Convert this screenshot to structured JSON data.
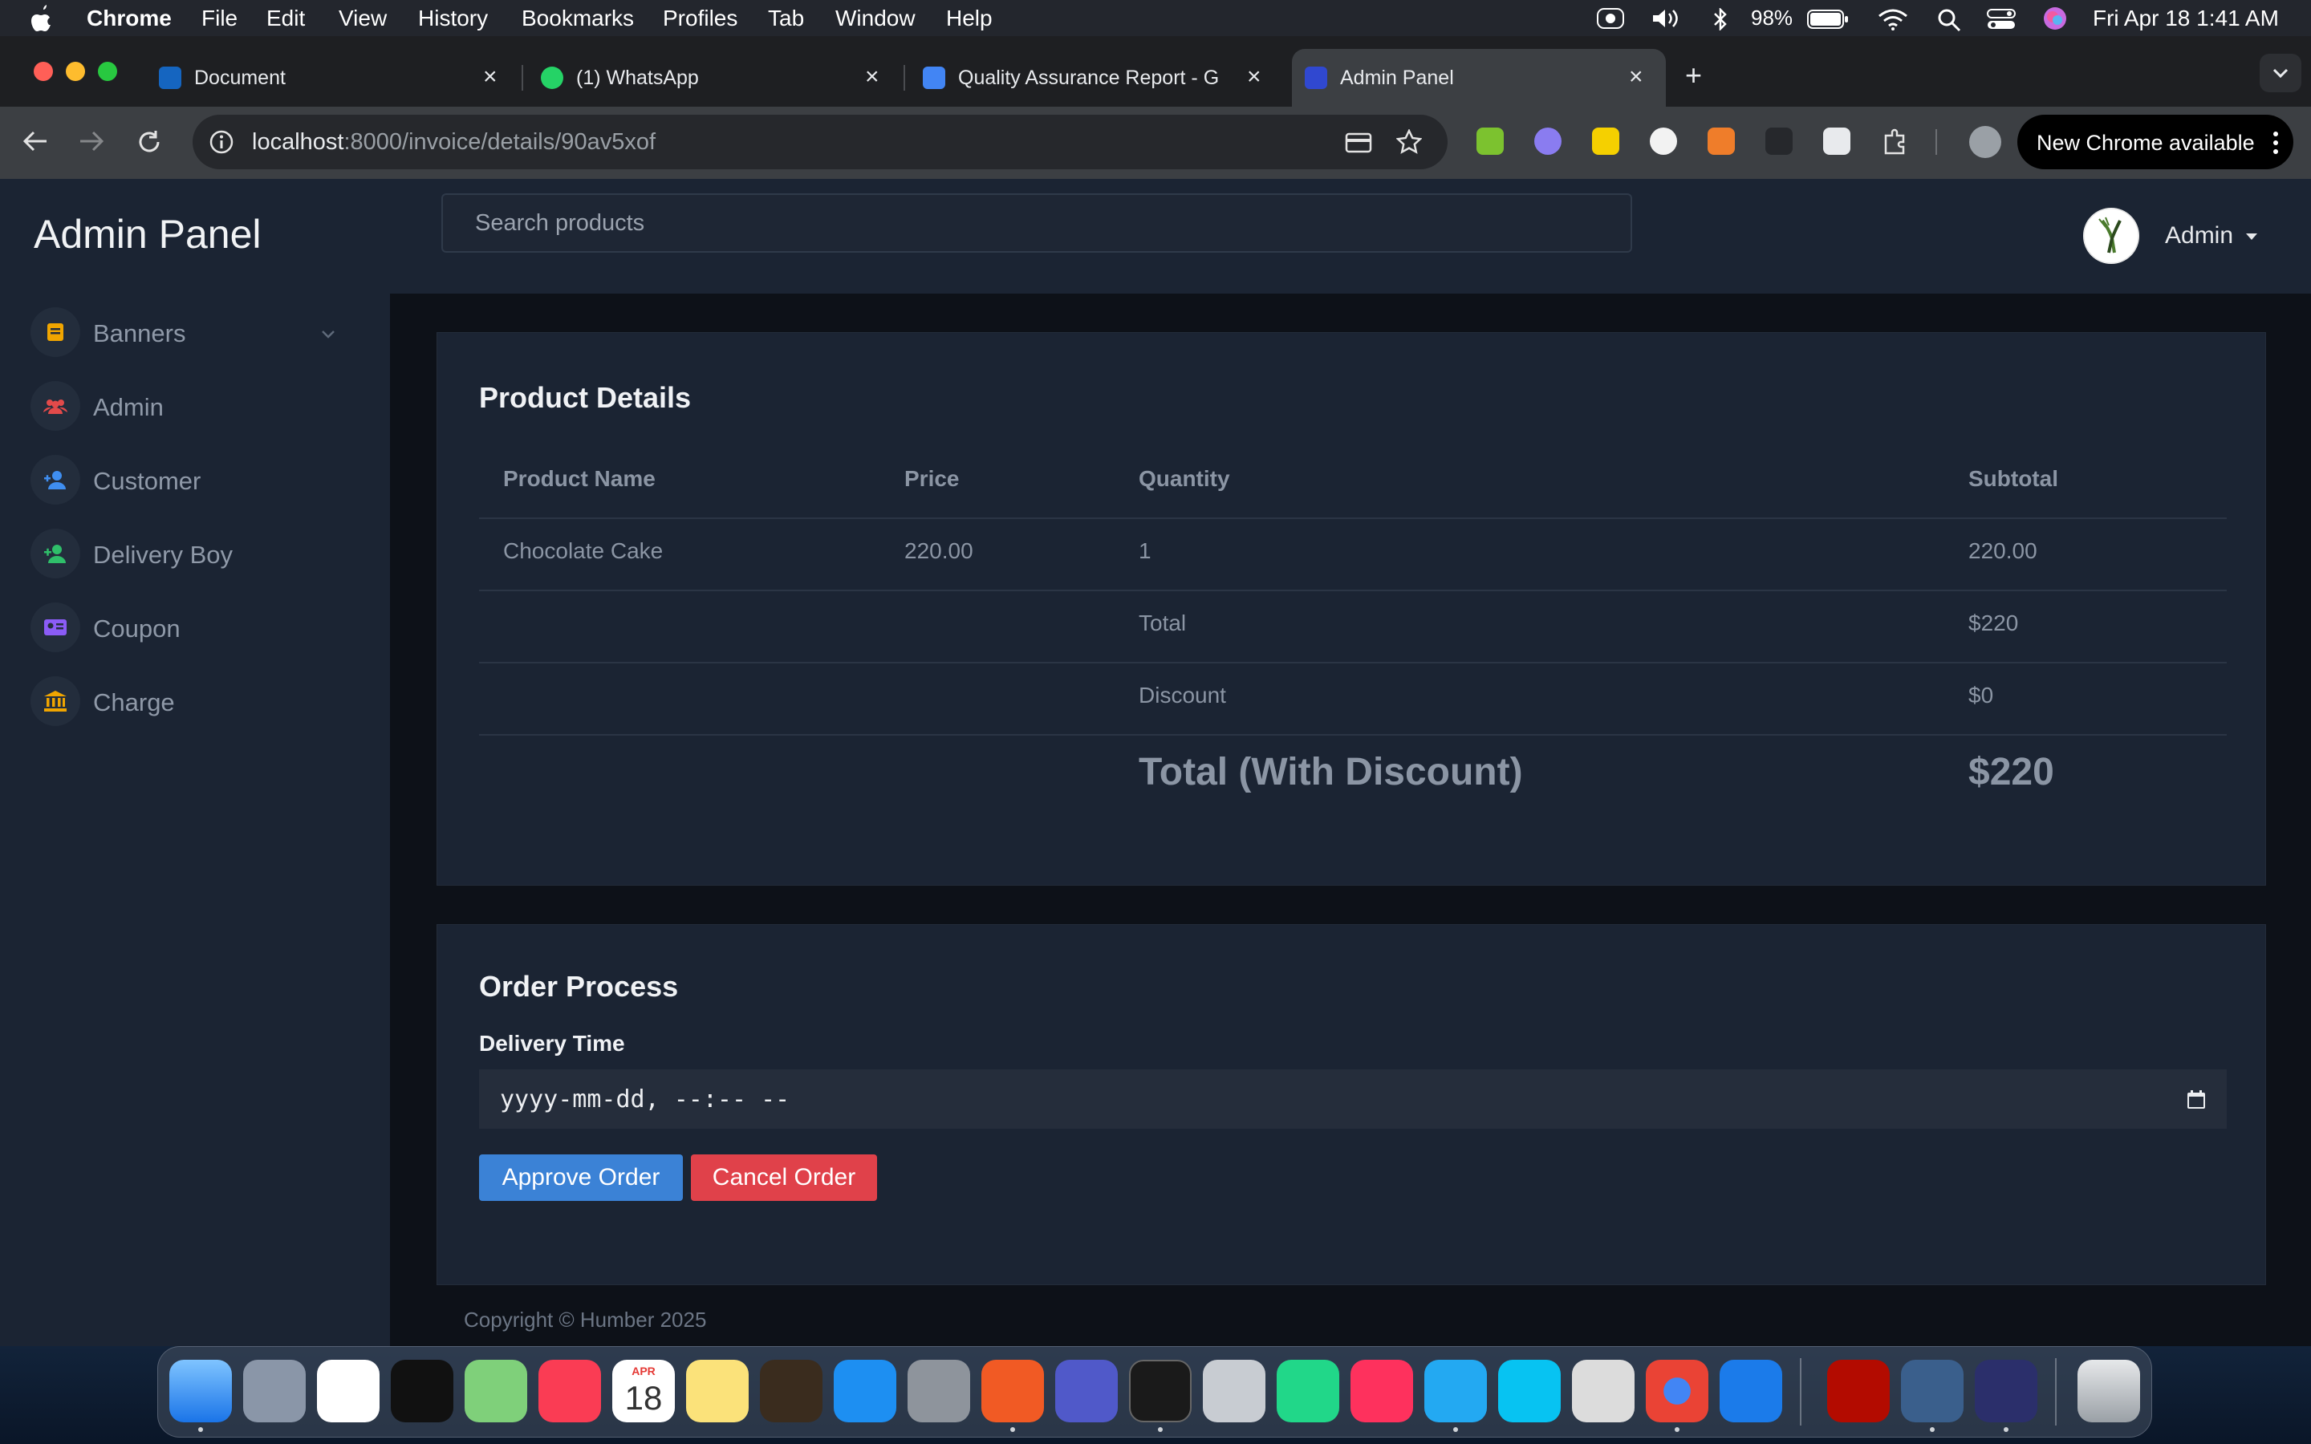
{
  "menubar": {
    "app_name": "Chrome",
    "items": [
      "File",
      "Edit",
      "View",
      "History",
      "Bookmarks",
      "Profiles",
      "Tab",
      "Window",
      "Help"
    ],
    "battery": "98%",
    "datetime": "Fri Apr 18  1:41 AM"
  },
  "tabs": [
    {
      "title": "Document"
    },
    {
      "title": "(1) WhatsApp"
    },
    {
      "title": "Quality Assurance Report - G"
    },
    {
      "title": "Admin Panel"
    }
  ],
  "toolbar": {
    "url_host": "localhost",
    "url_path": ":8000/invoice/details/90av5xof",
    "new_chrome_label": "New Chrome available"
  },
  "sidebar": {
    "title": "Admin Panel",
    "items": [
      {
        "label": "Banners",
        "icon": "document-icon",
        "color": "#f0a500"
      },
      {
        "label": "Admin",
        "icon": "users-icon",
        "color": "#e24a4a"
      },
      {
        "label": "Customer",
        "icon": "user-icon",
        "color": "#3f8ef0"
      },
      {
        "label": "Delivery Boy",
        "icon": "user-plus-icon",
        "color": "#2fbf6a"
      },
      {
        "label": "Coupon",
        "icon": "id-card-icon",
        "color": "#8b5cf6"
      },
      {
        "label": "Charge",
        "icon": "bank-icon",
        "color": "#f0a500"
      }
    ]
  },
  "header": {
    "search_placeholder": "Search products",
    "user_label": "Admin"
  },
  "product_details": {
    "title": "Product Details",
    "columns": [
      "Product Name",
      "Price",
      "Quantity",
      "Subtotal"
    ],
    "rows": [
      {
        "name": "Chocolate Cake",
        "price": "220.00",
        "quantity": "1",
        "subtotal": "220.00"
      }
    ],
    "total_label": "Total",
    "total_value": "$220",
    "discount_label": "Discount",
    "discount_value": "$0",
    "grand_total_label": "Total (With Discount)",
    "grand_total_value": "$220"
  },
  "order_process": {
    "title": "Order Process",
    "delivery_label": "Delivery Time",
    "delivery_placeholder": "yyyy-mm-dd, --:-- --",
    "approve_label": "Approve Order",
    "cancel_label": "Cancel Order"
  },
  "footer": {
    "text": "Copyright © Humber 2025"
  },
  "dock": {
    "apps": [
      "finder",
      "launchpad",
      "photos",
      "apple-tv",
      "maps",
      "music",
      "calendar",
      "notes",
      "garageband",
      "app-store",
      "system-settings",
      "brave",
      "teams",
      "terminal",
      "database",
      "pycharm",
      "intellij",
      "vscode",
      "webstorm",
      "tableplus",
      "chrome",
      "xcode-instruments",
      "acrobat",
      "mysql-workbench",
      "remote",
      "trash"
    ],
    "calendar_month": "APR",
    "calendar_day": "18"
  }
}
